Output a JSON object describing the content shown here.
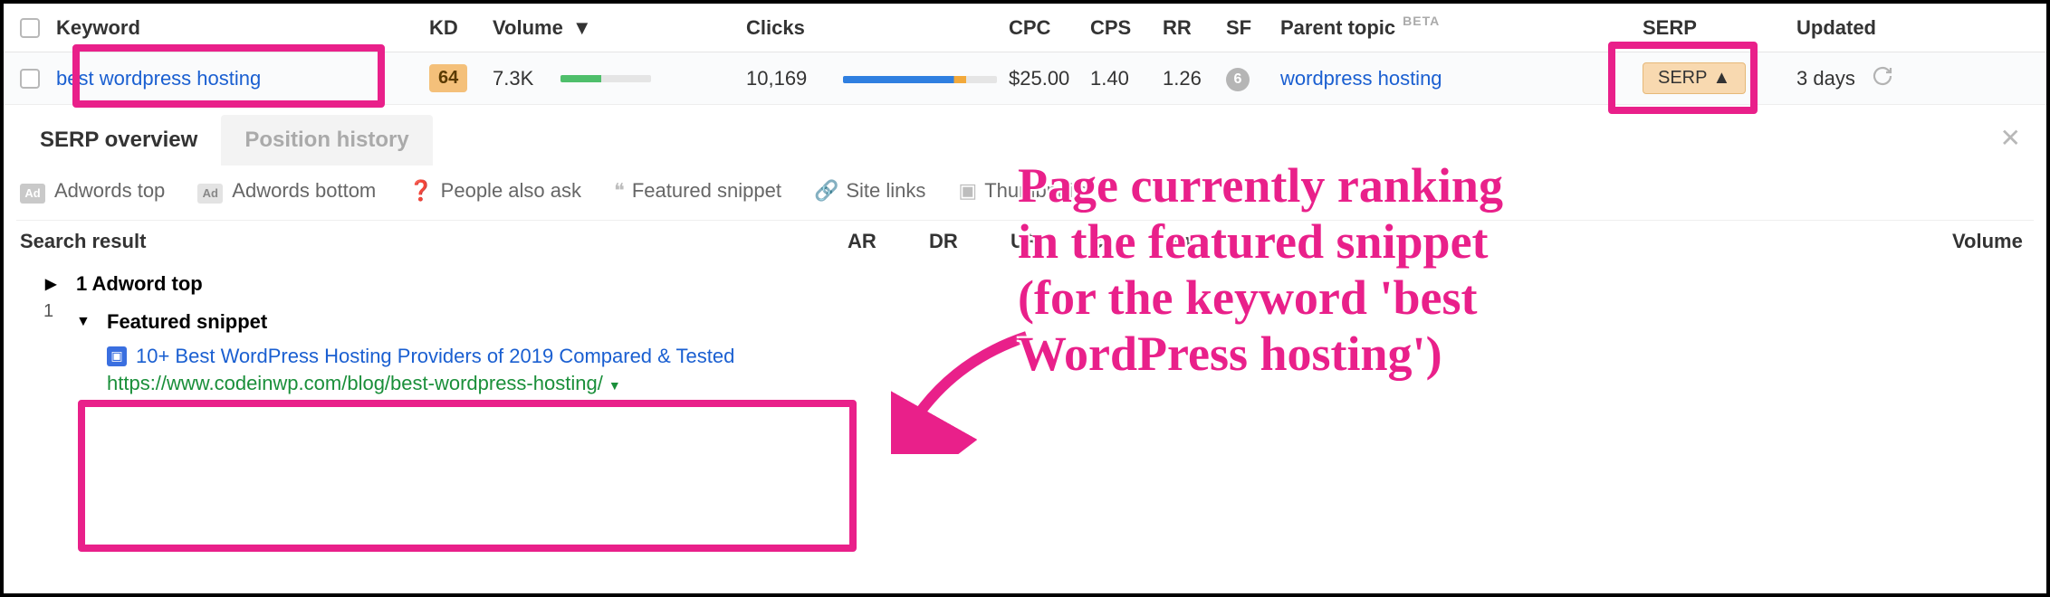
{
  "headers": {
    "keyword": "Keyword",
    "kd": "KD",
    "volume": "Volume",
    "clicks": "Clicks",
    "cpc": "CPC",
    "cps": "CPS",
    "rr": "RR",
    "sf": "SF",
    "parent_topic": "Parent topic",
    "beta": "BETA",
    "serp": "SERP",
    "updated": "Updated"
  },
  "row": {
    "keyword": "best wordpress hosting",
    "kd": "64",
    "volume": "7.3K",
    "clicks": "10,169",
    "cpc": "$25.00",
    "cps": "1.40",
    "rr": "1.26",
    "sf": "6",
    "parent_topic": "wordpress hosting",
    "serp_btn": "SERP",
    "updated": "3 days"
  },
  "panel": {
    "tab_active": "SERP overview",
    "tab_inactive": "Position history",
    "filters": {
      "adwords_top": "Adwords top",
      "adwords_bottom": "Adwords bottom",
      "people_also_ask": "People also ask",
      "featured_snippet": "Featured snippet",
      "site_links": "Site links",
      "thumbnails": "Thumbnails"
    },
    "results_header": {
      "label": "Search result",
      "ar": "AR",
      "dr": "DR",
      "ur": "UR",
      "cl": "cl",
      "m": "m",
      "volume": "Volume"
    },
    "adword_row": "1 Adword top",
    "snippet": {
      "num": "1",
      "heading": "Featured snippet",
      "title": "10+ Best WordPress Hosting Providers of 2019 Compared & Tested",
      "url": "https://www.codeinwp.com/blog/best-wordpress-hosting/"
    }
  },
  "annotation": {
    "l1": "Page currently ranking",
    "l2": "in the featured snippet",
    "l3": "(for the keyword 'best",
    "l4": "WordPress hosting')"
  }
}
